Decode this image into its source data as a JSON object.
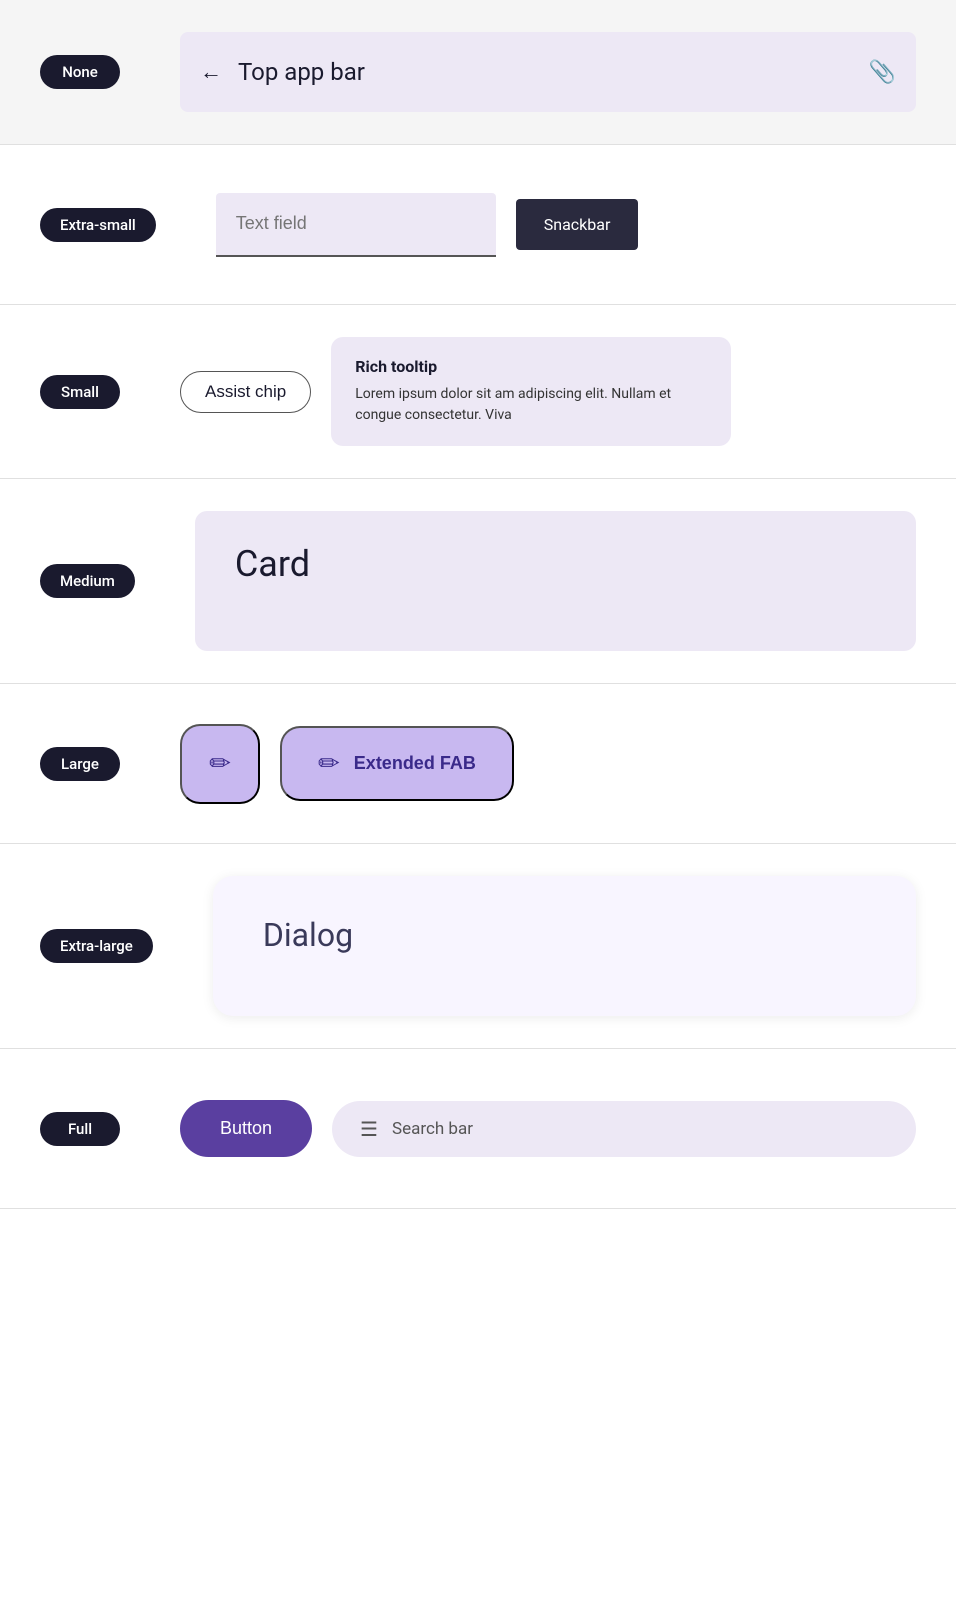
{
  "rows": [
    {
      "id": "none",
      "badge_label": "None",
      "component_type": "top-app-bar",
      "top_app_bar": {
        "title": "Top app bar",
        "back_icon": "←",
        "action_icon": "📎"
      }
    },
    {
      "id": "extra-small",
      "badge_label": "Extra-small",
      "component_type": "text-field-snackbar",
      "text_field": {
        "placeholder": "Text field"
      },
      "snackbar": {
        "label": "Snackbar"
      }
    },
    {
      "id": "small",
      "badge_label": "Small",
      "component_type": "assist-chip-tooltip",
      "assist_chip": {
        "label": "Assist chip"
      },
      "rich_tooltip": {
        "title": "Rich tooltip",
        "body": "Lorem ipsum dolor sit am adipiscing elit. Nullam et congue consectetur. Viva"
      }
    },
    {
      "id": "medium",
      "badge_label": "Medium",
      "component_type": "card",
      "card": {
        "title": "Card"
      }
    },
    {
      "id": "large",
      "badge_label": "Large",
      "component_type": "fab-extended-fab",
      "fab": {
        "icon": "✏"
      },
      "extended_fab": {
        "icon": "✏",
        "label": "Extended FAB"
      }
    },
    {
      "id": "extra-large",
      "badge_label": "Extra-large",
      "component_type": "dialog",
      "dialog": {
        "title": "Dialog"
      }
    },
    {
      "id": "full",
      "badge_label": "Full",
      "component_type": "button-searchbar",
      "button": {
        "label": "Button"
      },
      "search_bar": {
        "icon": "☰",
        "placeholder": "Search bar"
      }
    }
  ]
}
